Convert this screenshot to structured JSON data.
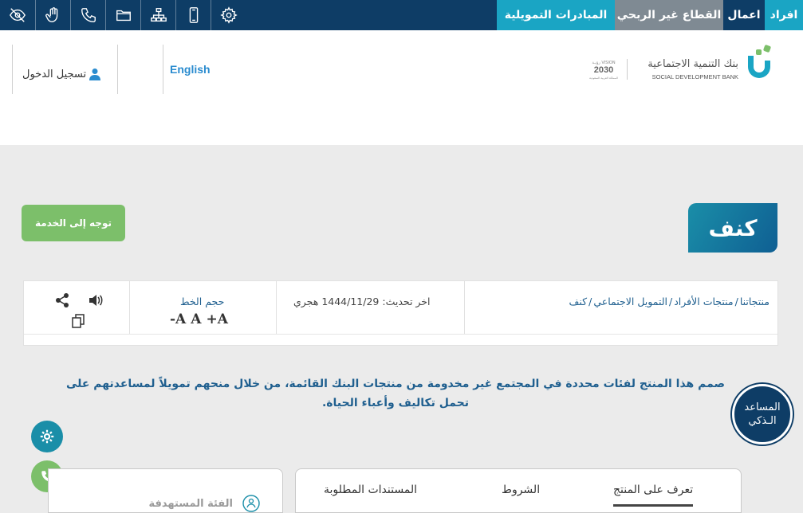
{
  "topbar": {
    "segments": [
      {
        "label": "افراد",
        "bg": "#1aa5c4"
      },
      {
        "label": "اعمال",
        "bg": "#0e3d66"
      },
      {
        "label": "القطاع غير الربحي",
        "bg": "#7f8a93"
      },
      {
        "label": "المبادرات التمويلية",
        "bg": "#1aa5c4"
      }
    ],
    "util_icons": [
      "eye-slash-icon",
      "hand-icon",
      "phone-icon",
      "folder-icon",
      "sitemap-icon",
      "mobile-icon",
      "gear-icon"
    ]
  },
  "header": {
    "logo_arabic": "بنك التنمية الاجتماعية",
    "logo_english": "SOCIAL DEVELOPMENT BANK",
    "vision_text": "رؤيـة VISION",
    "vision_year": "2030",
    "vision_sub": "المملكة العربية السعودية",
    "english_link": "English",
    "login_label": "تسجيل الدخول"
  },
  "page": {
    "title": "كنف",
    "service_button": "توجه إلى الخدمة"
  },
  "infobar": {
    "breadcrumb": [
      "منتجاتنا",
      "منتجات الأفراد",
      "التمويل الاجتماعي",
      "كنف"
    ],
    "breadcrumb_sep": "/",
    "updated_label": "اخر تحديث:",
    "updated_value": "1444/11/29 هجري",
    "fontsize_label": "حجم الخط",
    "font_decrease": "-A",
    "font_reset": "A",
    "font_increase": "+A"
  },
  "description": {
    "line1": "صمم هذا المنتج لفئات محددة في المجتمع غير مخدومة من منتجات البنك القائمة، من خلال منحهم تمويلاً لمساعدتهم على",
    "line2": "تحمل تكاليف وأعباء الحياة."
  },
  "assistant": {
    "line1": "المساعد",
    "line2": "الـذكي"
  },
  "tabs": {
    "items": [
      "تعرف على المنتج",
      "الشروط",
      "المستندات المطلوبة"
    ]
  },
  "side_panel": {
    "label": "الفئة المستهدفة"
  },
  "colors": {
    "navy": "#0e3d66",
    "teal": "#1aa5c4",
    "green": "#7cbf6a",
    "text_blue": "#1f5f8f",
    "fab_settings": "#1a8ea8",
    "fab_phone": "#7cbf6a"
  }
}
